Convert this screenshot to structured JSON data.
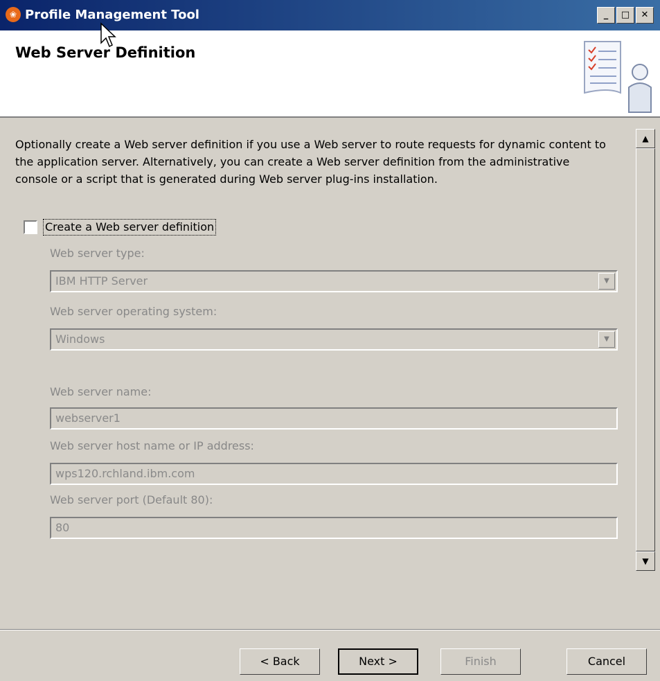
{
  "window": {
    "title": "Profile Management Tool",
    "icon": "app-icon",
    "controls": {
      "minimize": "_",
      "maximize": "□",
      "close": "✕"
    }
  },
  "header": {
    "title": "Web Server Definition",
    "icon": "wizard-checklist-person-icon"
  },
  "description": "Optionally create a Web server definition if you use a Web server to route requests for dynamic content to the application server. Alternatively, you can create a Web server definition from the administrative console or a script that is generated during Web server plug-ins installation.",
  "create_definition": {
    "label": "Create a Web server definition",
    "checked": false
  },
  "fields": {
    "server_type_label": "Web server type:",
    "server_type_value": "IBM HTTP Server",
    "os_label": "Web server operating system:",
    "os_value": "Windows",
    "name_label": "Web server name:",
    "name_value": "webserver1",
    "host_label": "Web server host name or IP address:",
    "host_value": "wps120.rchland.ibm.com",
    "port_label": "Web server port (Default 80):",
    "port_value": "80"
  },
  "buttons": {
    "back": "< Back",
    "next": "Next >",
    "finish": "Finish",
    "cancel": "Cancel"
  },
  "colors": {
    "titlebar_start": "#0a246a",
    "titlebar_end": "#3a6ea5",
    "dialog_bg": "#d4d0c8",
    "disabled_text": "#888888"
  }
}
